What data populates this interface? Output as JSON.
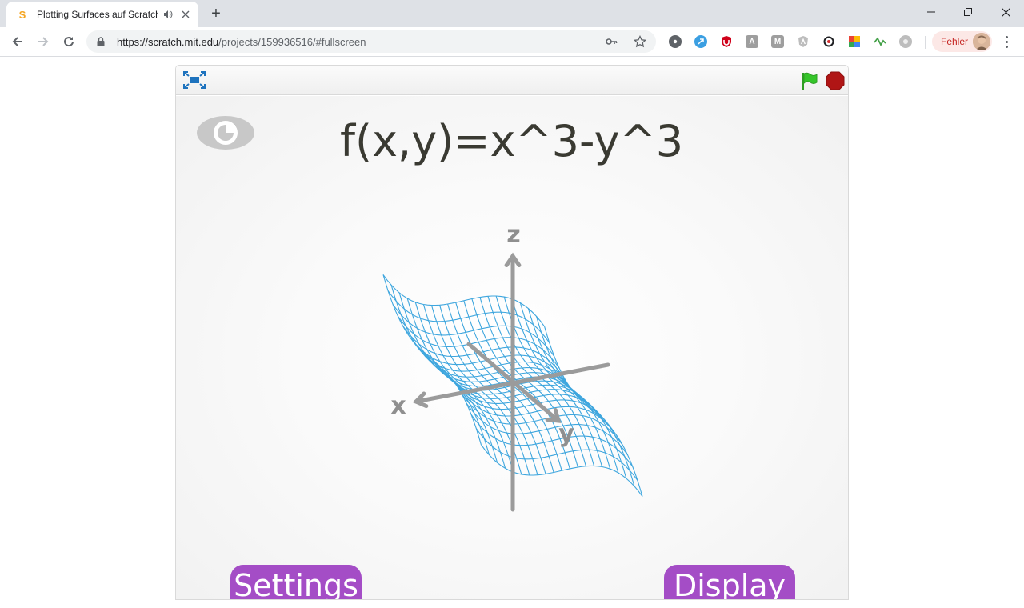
{
  "browser": {
    "tab_title": "Plotting Surfaces auf Scratch",
    "favicon_glyph": "S",
    "new_tab_symbol": "+",
    "url_host": "https://scratch.mit.edu",
    "url_path": "/projects/159936516/#fullscreen",
    "profile_label": "Fehler",
    "extensions": [
      {
        "name": "gear-extension-icon",
        "color": "#5f6368"
      },
      {
        "name": "bitwarden-extension-icon",
        "color": "#3b9fe2"
      },
      {
        "name": "ublock-extension-icon",
        "color": "#d0021b"
      },
      {
        "name": "a-extension-icon",
        "color": "#9e9e9e"
      },
      {
        "name": "m-extension-icon",
        "color": "#9e9e9e"
      },
      {
        "name": "angular-extension-icon",
        "color": "#bdbdbd"
      },
      {
        "name": "sync-extension-icon",
        "color": "#202124"
      },
      {
        "name": "colorful-extension-icon",
        "color": "#4caf50"
      },
      {
        "name": "pulse-extension-icon",
        "color": "#43a047"
      },
      {
        "name": "circle-extension-icon",
        "color": "#9e9e9e"
      }
    ],
    "ext_glyphs": {
      "a": "A",
      "m": "M"
    }
  },
  "scratch": {
    "formula": "f(x,y)=x^3-y^3",
    "axis_labels": {
      "z": "z",
      "x": "x",
      "y": "y"
    },
    "settings_label": "Settings",
    "display_label": "Display",
    "colors": {
      "mesh": "#3ea6de",
      "axis": "#9b9b9b",
      "button": "#a44dc6",
      "flag": "#35c52a",
      "stop": "#b01515",
      "fullscreen_icon": "#1e73be"
    }
  }
}
